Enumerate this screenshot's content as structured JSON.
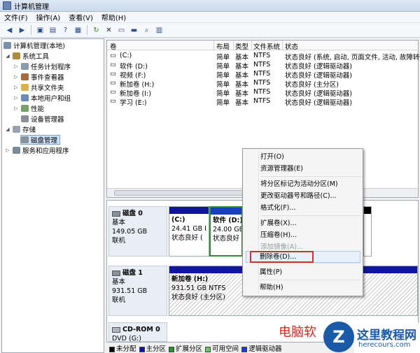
{
  "window": {
    "title": "计算机管理"
  },
  "menu": [
    "文件(F)",
    "操作(A)",
    "查看(V)",
    "帮助(H)"
  ],
  "toolbar_icons": [
    "back-icon",
    "forward-icon",
    "up-icon",
    "show-hide-tree-icon",
    "help-icon",
    "properties-icon",
    "refresh-icon",
    "delete-icon",
    "disk-icon",
    "new-disk-icon",
    "search-icon",
    "view-icon"
  ],
  "tree": {
    "root": "计算机管理(本地)",
    "system_tools": "系统工具",
    "items": [
      "任务计划程序",
      "事件查看器",
      "共享文件夹",
      "本地用户和组",
      "性能",
      "设备管理器"
    ],
    "storage": "存储",
    "disk_mgmt": "磁盘管理",
    "services": "服务和应用程序"
  },
  "volume_list": {
    "headers": [
      "卷",
      "布局",
      "类型",
      "文件系统",
      "状态"
    ],
    "rows": [
      {
        "vol": "(C:)",
        "layout": "简单",
        "type": "基本",
        "fs": "NTFS",
        "status": "状态良好 (系统, 启动, 页面文件, 活动, 故障转储"
      },
      {
        "vol": "软件 (D:)",
        "layout": "简单",
        "type": "基本",
        "fs": "NTFS",
        "status": "状态良好 (逻辑驱动器)"
      },
      {
        "vol": "视频 (F:)",
        "layout": "简单",
        "type": "基本",
        "fs": "NTFS",
        "status": "状态良好 (逻辑驱动器)"
      },
      {
        "vol": "新加卷 (H:)",
        "layout": "简单",
        "type": "基本",
        "fs": "NTFS",
        "status": "状态良好 (主分区)"
      },
      {
        "vol": "新加卷 (I:)",
        "layout": "简单",
        "type": "基本",
        "fs": "NTFS",
        "status": "状态良好 (逻辑驱动器)"
      },
      {
        "vol": "学习 (E:)",
        "layout": "简单",
        "type": "基本",
        "fs": "NTFS",
        "status": "状态良好 (逻辑驱动器)"
      }
    ]
  },
  "disks": {
    "disk0": {
      "name": "磁盘 0",
      "type": "基本",
      "size": "149.05 GB",
      "state": "联机",
      "c": {
        "name": "(C:)",
        "size": "24.41 GB I",
        "state": "状态良好 ("
      },
      "d": {
        "name": "软件 (D:)",
        "size": "24.00 GB",
        "state": "状态良好 ("
      }
    },
    "disk1": {
      "name": "磁盘 1",
      "type": "基本",
      "size": "931.51 GB",
      "state": "联机",
      "h": {
        "name": "新加卷 (H:)",
        "size": "931.51 GB NTFS",
        "state": "状态良好 (主分区)"
      }
    },
    "cdrom": {
      "name": "CD-ROM 0",
      "drive": "DVD (G:)"
    }
  },
  "legend": {
    "items": [
      "未分配",
      "主分区",
      "扩展分区",
      "可用空间",
      "逻辑驱动器"
    ],
    "colors": [
      "#000000",
      "#11179b",
      "#2b8f2b",
      "#6ec26e",
      "#1a3fbf"
    ]
  },
  "context_menu": {
    "items": [
      "打开(O)",
      "资源管理器(E)",
      "将分区标记为活动分区(M)",
      "更改驱动器号和路径(C)...",
      "格式化(F)...",
      "扩展卷(X)...",
      "压缩卷(H)...",
      "添加镜像(A)...",
      "删除卷(D)...",
      "属性(P)",
      "帮助(H)"
    ]
  },
  "watermark": {
    "text": "电脑软",
    "logo": "Z",
    "brand": "这里教程网",
    "url": "herecours.com"
  }
}
